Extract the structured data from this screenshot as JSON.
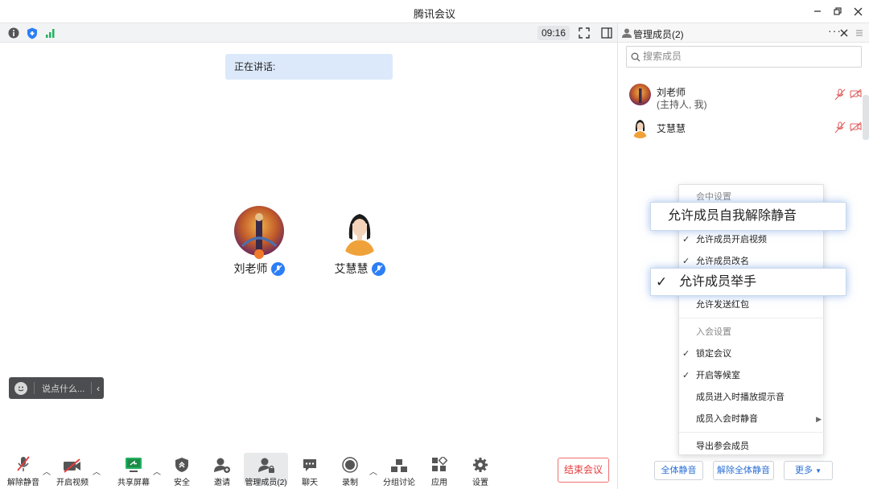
{
  "window": {
    "title": "腾讯会议"
  },
  "topbar": {
    "timer": "09:16"
  },
  "main": {
    "speaking_label": "正在讲话:",
    "participants": [
      {
        "name": "刘老师"
      },
      {
        "name": "艾慧慧"
      }
    ],
    "chat_placeholder": "说点什么..."
  },
  "toolbar": {
    "unmute": "解除静音",
    "start_video": "开启视频",
    "share_screen": "共享屏幕",
    "security": "安全",
    "invite": "邀请",
    "manage_members": "管理成员(2)",
    "chat": "聊天",
    "record": "录制",
    "breakout": "分组讨论",
    "apps": "应用",
    "settings": "设置",
    "end_meeting": "结束会议"
  },
  "panel": {
    "title": "管理成员(2)",
    "search_placeholder": "搜索成员",
    "members": [
      {
        "name": "刘老师",
        "role": "(主持人, 我)"
      },
      {
        "name": "艾慧慧",
        "role": ""
      }
    ],
    "footer": {
      "mute_all": "全体静音",
      "unmute_all": "解除全体静音",
      "more": "更多"
    }
  },
  "menu": {
    "section_in_meeting": "会中设置",
    "allow_self_unmute": "允许成员自我解除静音",
    "allow_open_video": "允许成员开启视频",
    "allow_rename": "允许成员改名",
    "allow_raise_hand": "允许成员举手",
    "allow_red_packet": "允许发送红包",
    "section_join": "入会设置",
    "lock_meeting": "锁定会议",
    "waiting_room": "开启等候室",
    "join_sound": "成员进入时播放提示音",
    "mute_on_join": "成员入会时静音",
    "export_members": "导出参会成员"
  },
  "colors": {
    "accent": "#2b7ef6",
    "danger": "#e63b3b",
    "speaking_bg": "#dce9fb"
  }
}
